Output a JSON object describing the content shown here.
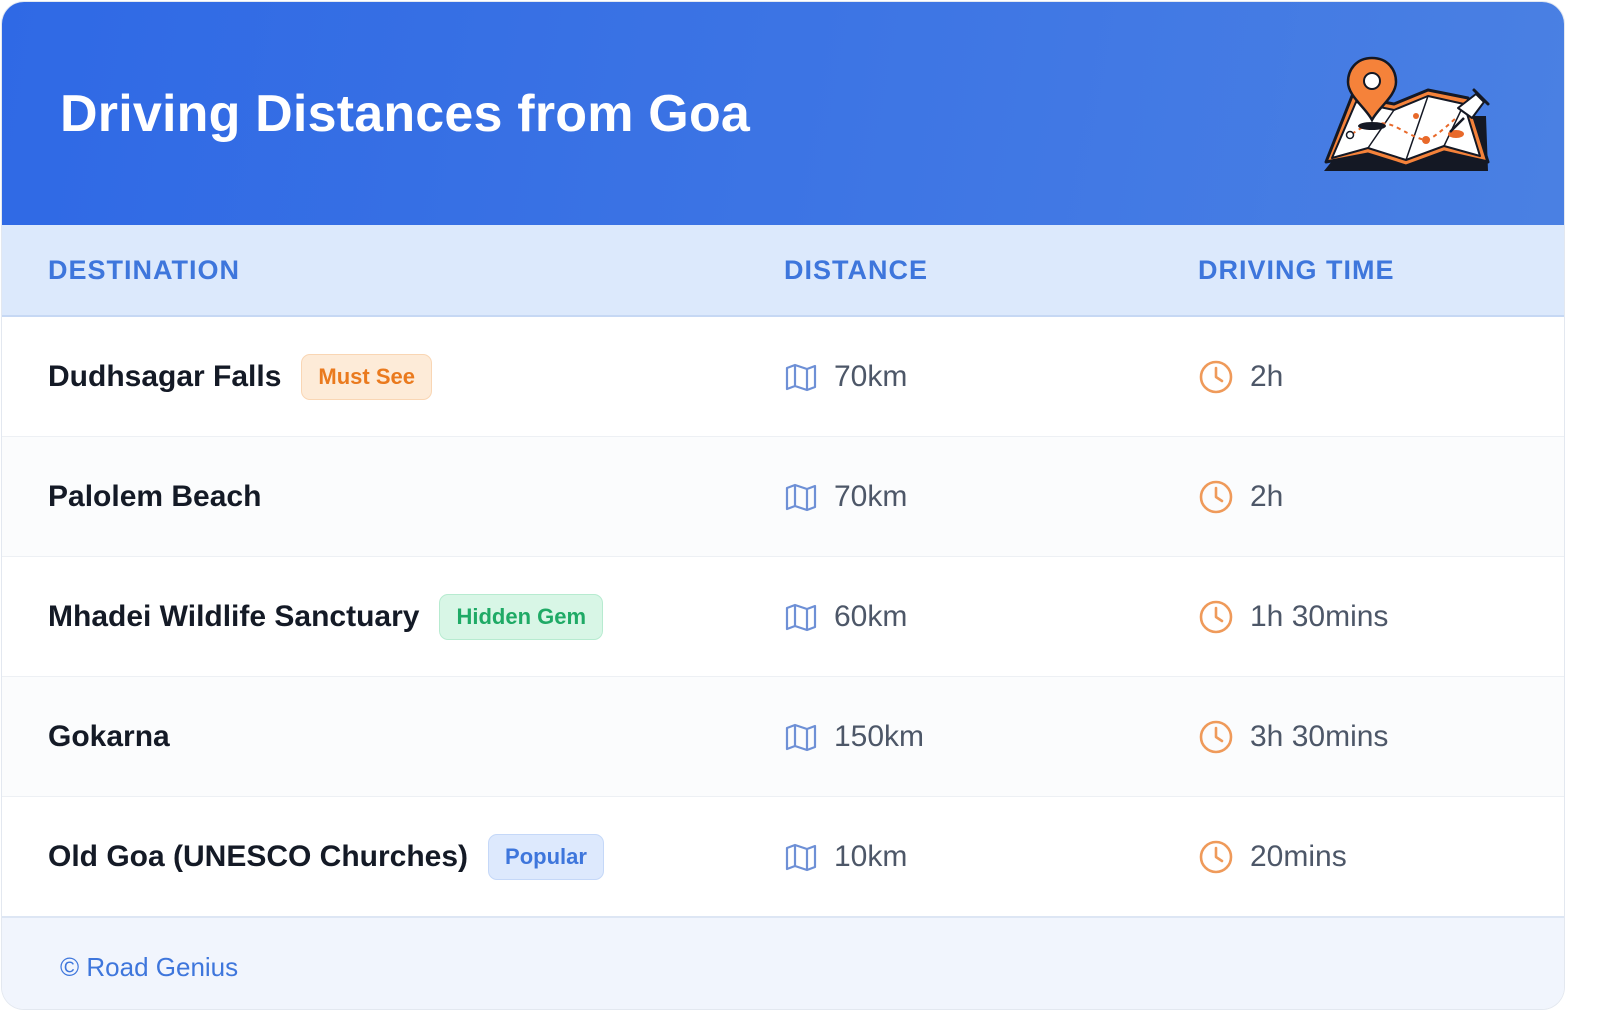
{
  "header": {
    "title": "Driving Distances from Goa"
  },
  "table": {
    "columns": [
      "DESTINATION",
      "DISTANCE",
      "DRIVING TIME"
    ],
    "rows": [
      {
        "destination": "Dudhsagar Falls",
        "badge": "Must See",
        "distance": "70km",
        "time": "2h"
      },
      {
        "destination": "Palolem Beach",
        "badge": "",
        "distance": "70km",
        "time": "2h"
      },
      {
        "destination": "Mhadei Wildlife Sanctuary",
        "badge": "Hidden Gem",
        "distance": "60km",
        "time": "1h 30mins"
      },
      {
        "destination": "Gokarna",
        "badge": "",
        "distance": "150km",
        "time": "3h 30mins"
      },
      {
        "destination": "Old Goa (UNESCO Churches)",
        "badge": "Popular",
        "distance": "10km",
        "time": "20mins"
      }
    ]
  },
  "footer": {
    "credit": "© Road Genius"
  },
  "icons": {
    "distance": "map-icon",
    "time": "clock-icon",
    "header": "map-pin-illustration"
  },
  "colors": {
    "header_start": "#2f69e5",
    "header_end": "#4a80e3",
    "accent_blue": "#3e76dc",
    "accent_orange": "#ea7a1e",
    "accent_green": "#1faa66"
  }
}
